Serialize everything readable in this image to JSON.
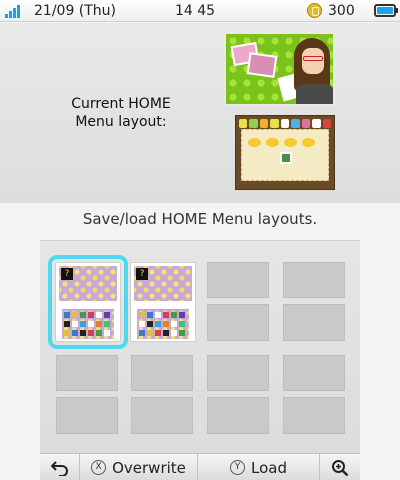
{
  "status_bar": {
    "date": "21/09 (Thu)",
    "time": "14 45",
    "coins": "300",
    "icons": [
      "signal-icon",
      "play-coin-icon",
      "battery-icon"
    ],
    "accent_color": "#1da0e6"
  },
  "top_screen": {
    "current_layout_label": "Current HOME\nMenu layout:"
  },
  "caption": "Save/load HOME Menu layouts.",
  "slots": [
    {
      "state": "saved",
      "selected": true,
      "badge": "?"
    },
    {
      "state": "saved",
      "selected": false,
      "badge": "?"
    },
    {
      "state": "empty"
    },
    {
      "state": "empty"
    },
    {
      "state": "empty"
    },
    {
      "state": "empty"
    },
    {
      "state": "empty"
    },
    {
      "state": "empty"
    }
  ],
  "toolbar": {
    "back_icon": "back-arrow-icon",
    "overwrite_button_glyph": "X",
    "overwrite_label": "Overwrite",
    "load_button_glyph": "Y",
    "load_label": "Load",
    "zoom_icon": "zoom-in-icon"
  },
  "colors": {
    "selection": "#4fd8ee",
    "battery": "#1aa5ea",
    "coin": "#e0bd2a"
  }
}
